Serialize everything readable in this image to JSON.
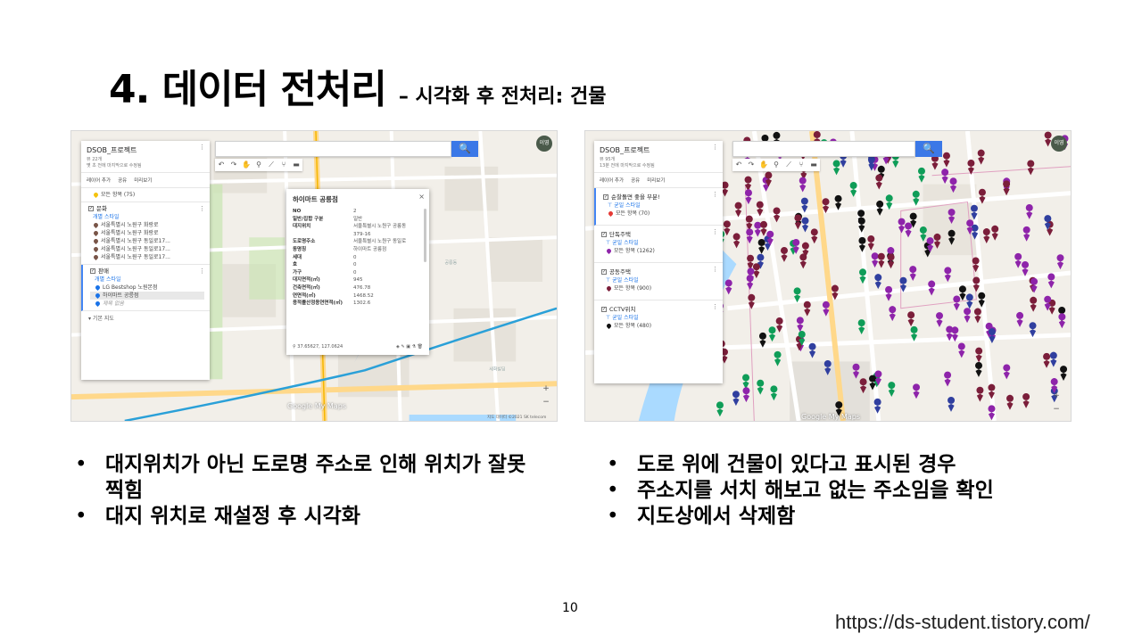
{
  "slide": {
    "title_main": "4. 데이터 전처리",
    "title_sub": "– 시각화 후 전처리: 건물",
    "page_number": "10",
    "footer_url": "https://ds-student.tistory.com/"
  },
  "left_shot": {
    "search_button": "🔍",
    "avatar": "이영",
    "project_title": "DSOB_프로젝트",
    "project_meta1": "뷰 22개",
    "project_meta2": "몇 초 전에 마지막으로 수정됨",
    "actions": [
      "레이어 추가",
      "공유",
      "미리보기"
    ],
    "top_layer_item": "모든 항목 (75)",
    "layers": [
      {
        "name": "문화",
        "style": "개별 스타일",
        "items": [
          "서울특별시 노원구 화랑로",
          "서울특별시 노원구 화랑로",
          "서울특별시 노원구 동일로17...",
          "서울특별시 노원구 동일로17...",
          "서울특별시 노원구 동일로17..."
        ]
      },
      {
        "name": "판매",
        "style": "개별 스타일",
        "items": [
          "LG Bestshop 노원본점",
          "하이마트 공릉점",
          "제목 없음"
        ]
      }
    ],
    "base_map": "기본 지도",
    "popup": {
      "title": "하이마트 공릉점",
      "rows": [
        {
          "k": "NO",
          "v": "2"
        },
        {
          "k": "일반/집합 구분",
          "v": "일반"
        },
        {
          "k": "대지위치",
          "v": "서울특별시 노원구 공릉동"
        },
        {
          "k": "",
          "v": "379-16"
        },
        {
          "k": "도로명주소",
          "v": "서울특별시 노원구 동일로"
        },
        {
          "k": "동명칭",
          "v": "하이마트 공릉점"
        },
        {
          "k": "세대",
          "v": "0"
        },
        {
          "k": "호",
          "v": "0"
        },
        {
          "k": "가구",
          "v": "0"
        },
        {
          "k": "대지면적(㎡)",
          "v": "945"
        },
        {
          "k": "건축면적(㎡)",
          "v": "476.78"
        },
        {
          "k": "연면적(㎡)",
          "v": "1468.52"
        },
        {
          "k": "용적률산정용연면적(㎡)",
          "v": "1302.6"
        }
      ],
      "coords": "37.65627, 127.0624"
    },
    "google_brand": "Google My Maps",
    "credit": "지도 데이터 ©2021 SK telecom"
  },
  "right_shot": {
    "search_button": "🔍",
    "avatar": "이영",
    "project_title": "DSOB_프로젝트",
    "project_meta1": "뷰 95개",
    "project_meta2": "13분 전에 마지막으로 수정됨",
    "actions": [
      "레이어 추가",
      "공유",
      "미리보기"
    ],
    "layers": [
      {
        "name": "순찰돌면 좋을 부분!",
        "style": "균일 스타일",
        "item": "모든 항목 (70)"
      },
      {
        "name": "단독주택",
        "style": "균일 스타일",
        "item": "모든 항목 (1262)"
      },
      {
        "name": "공동주택",
        "style": "균일 스타일",
        "item": "모든 항목 (900)"
      },
      {
        "name": "CCTV위치",
        "style": "균일 스타일",
        "item": "모든 항목 (480)"
      }
    ],
    "google_brand": "Google My Maps"
  },
  "bullets_left": [
    "대지위치가 아닌 도로명 주소로 인해 위치가 잘못 찍힘",
    "대지 위치로 재설정 후 시각화"
  ],
  "bullets_right": [
    "도로 위에 건물이 있다고 표시된 경우",
    "주소지를 서치 해보고 없는 주소임을 확인",
    "지도상에서 삭제함"
  ],
  "colors": {
    "map_bg": "#f2efe9",
    "road_major": "#ffd88a",
    "road": "#ffffff",
    "water": "#aadaff",
    "park": "#c8e6b0",
    "subway": "#2aa0d8",
    "pin_purple": "#8e24aa",
    "pin_maroon": "#7b1e3a",
    "pin_green": "#0f9d58",
    "pin_black": "#111111",
    "pin_navy": "#303f9f",
    "accent_blue": "#4285f4"
  }
}
